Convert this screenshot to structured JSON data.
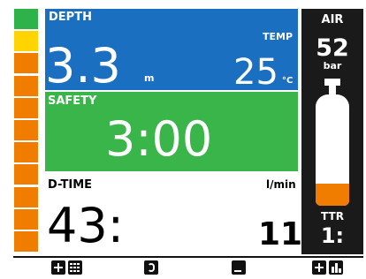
{
  "ascent_bar": {
    "segments": [
      "#2db34a",
      "#ffd400",
      "#f07d00",
      "#f07d00",
      "#f07d00",
      "#f07d00",
      "#f07d00",
      "#f07d00",
      "#f07d00",
      "#f07d00",
      "#f07d00"
    ]
  },
  "depth": {
    "label": "DEPTH",
    "value": "3.3",
    "unit": "m",
    "color": "#1a6fc0"
  },
  "temp": {
    "label": "TEMP",
    "value": "25",
    "unit": "°C"
  },
  "safety": {
    "label": "SAFETY",
    "value": "3:00",
    "color": "#3ab54a"
  },
  "dive_time": {
    "label": "D-TIME",
    "value": "43:"
  },
  "ascent_rate": {
    "label": "l/min",
    "value": "11"
  },
  "air": {
    "label": "AIR",
    "value": "52",
    "unit": "bar",
    "tank_level": 0.2,
    "tank_fill_color": "#f07d00"
  },
  "ttr": {
    "label": "TTR",
    "value": "1:"
  },
  "buttons": {
    "left_icons": [
      "plus-icon",
      "grid-icon"
    ],
    "center_left_icon": "dive-swap-icon",
    "center_right_icon": "plus-minus-icon",
    "right_icons": [
      "plus-icon",
      "bar-chart-icon"
    ]
  }
}
